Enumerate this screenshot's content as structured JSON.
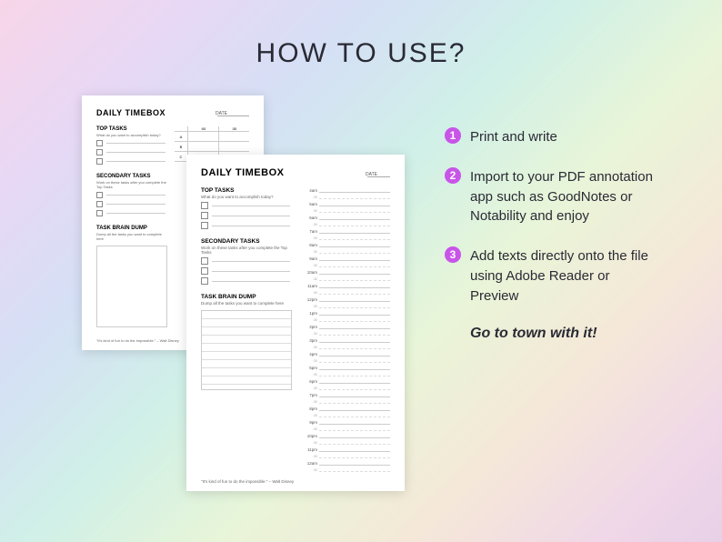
{
  "heading": "HOW TO USE?",
  "planner": {
    "title": "DAILY TIMEBOX",
    "date_label": "DATE",
    "sections": {
      "top_tasks": {
        "title": "TOP TASKS",
        "subtitle": "What do you want to accomplish today?"
      },
      "secondary_tasks": {
        "title": "SECONDARY TASKS",
        "subtitle": "Work on these tasks after you complete the Top Tasks"
      },
      "brain_dump": {
        "title": "TASK BRAIN DUMP",
        "subtitle": "Dump all the tasks you want to complete here"
      }
    },
    "back_table": {
      "row_labels": [
        "A",
        "B",
        "C"
      ],
      "col_labels": [
        ":00",
        ":30"
      ]
    },
    "schedule_hours": [
      "4am",
      "5am",
      "6am",
      "7am",
      "8am",
      "9am",
      "10am",
      "11am",
      "12pm",
      "1pm",
      "2pm",
      "3pm",
      "4pm",
      "5pm",
      "6pm",
      "7pm",
      "8pm",
      "9pm",
      "10pm",
      "11pm",
      "12am"
    ],
    "half_label": ":30",
    "quote": "\"It's kind of fun to do the impossible.\" – Walt Disney"
  },
  "instructions": [
    {
      "num": "1",
      "text": "Print and write"
    },
    {
      "num": "2",
      "text": "Import to your PDF annotation app such as GoodNotes or Notability and enjoy"
    },
    {
      "num": "3",
      "text": "Add texts directly onto the file using Adobe Reader or Preview"
    }
  ],
  "cta": "Go to town with it!"
}
